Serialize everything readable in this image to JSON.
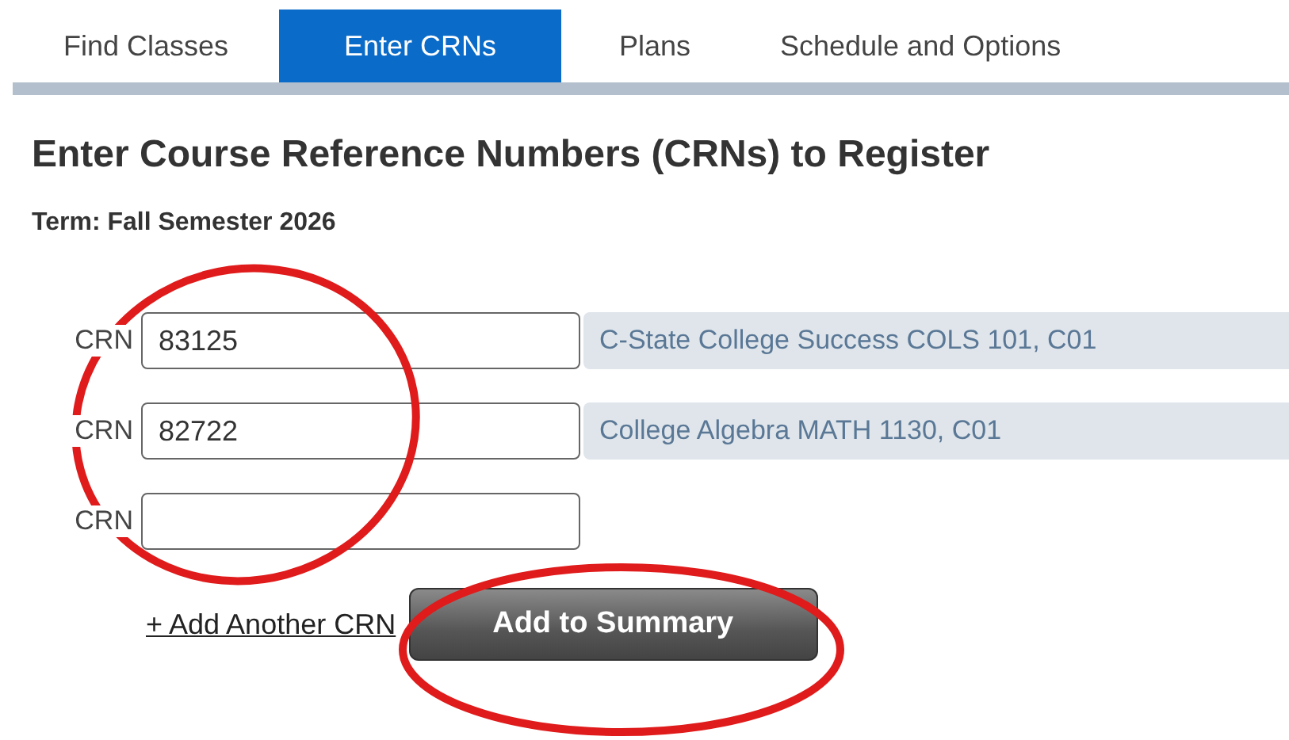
{
  "tabs": [
    {
      "label": "Find Classes",
      "selected": false
    },
    {
      "label": "Enter CRNs",
      "selected": true
    },
    {
      "label": "Plans",
      "selected": false
    },
    {
      "label": "Schedule and Options",
      "selected": false
    }
  ],
  "heading": "Enter Course Reference Numbers (CRNs) to Register",
  "term": "Term: Fall Semester 2026",
  "rows": [
    {
      "label": "CRN",
      "value": "83125",
      "course": "C-State College Success COLS 101, C01"
    },
    {
      "label": "CRN",
      "value": "82722",
      "course": "College Algebra MATH 1130, C01"
    },
    {
      "label": "CRN"
    }
  ],
  "add_link": "+ Add Another CRN",
  "submit_button": "Add to Summary"
}
